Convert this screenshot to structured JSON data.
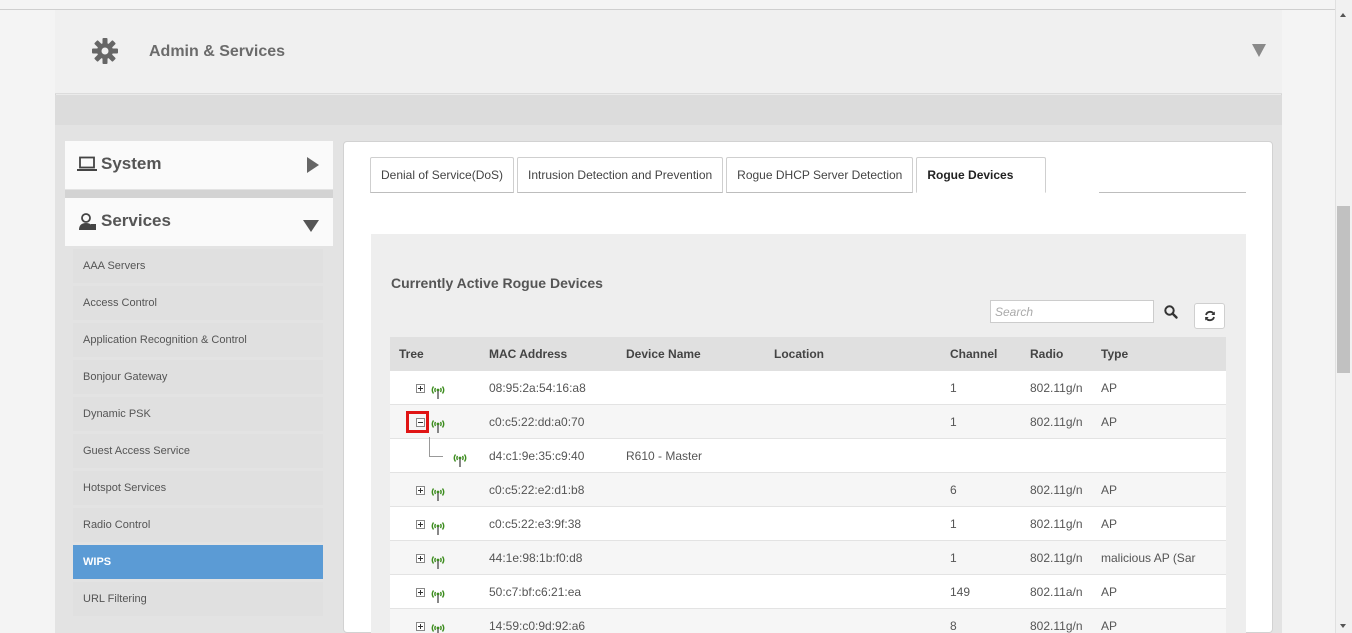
{
  "header": {
    "title": "Admin & Services",
    "icon": "gear-icon"
  },
  "nav": {
    "system": {
      "label": "System",
      "icon": "laptop-icon"
    },
    "services": {
      "label": "Services",
      "icon": "services-icon"
    },
    "items": [
      {
        "label": "AAA Servers",
        "active": false
      },
      {
        "label": "Access Control",
        "active": false
      },
      {
        "label": "Application Recognition & Control",
        "active": false
      },
      {
        "label": "Bonjour Gateway",
        "active": false
      },
      {
        "label": "Dynamic PSK",
        "active": false
      },
      {
        "label": "Guest Access Service",
        "active": false
      },
      {
        "label": "Hotspot Services",
        "active": false
      },
      {
        "label": "Radio Control",
        "active": false
      },
      {
        "label": "WIPS",
        "active": true
      },
      {
        "label": "URL Filtering",
        "active": false
      }
    ]
  },
  "tabs": [
    {
      "label": "Denial of Service(DoS)",
      "active": false
    },
    {
      "label": "Intrusion Detection and Prevention",
      "active": false
    },
    {
      "label": "Rogue DHCP Server Detection",
      "active": false
    },
    {
      "label": "Rogue Devices",
      "active": true
    }
  ],
  "section": {
    "title": "Currently Active Rogue Devices"
  },
  "search": {
    "placeholder": "Search"
  },
  "table": {
    "headers": [
      "Tree",
      "MAC Address",
      "Device Name",
      "Location",
      "Channel",
      "Radio",
      "Type"
    ],
    "rows": [
      {
        "mac": "08:95:2a:54:16:a8",
        "name": "",
        "location": "",
        "channel": "1",
        "radio": "802.11g/n",
        "type": "AP",
        "state": "collapsed"
      },
      {
        "mac": "c0:c5:22:dd:a0:70",
        "name": "",
        "location": "",
        "channel": "1",
        "radio": "802.11g/n",
        "type": "AP",
        "state": "expanded"
      },
      {
        "mac": "d4:c1:9e:35:c9:40",
        "name": "R610 - Master",
        "location": "",
        "channel": "",
        "radio": "",
        "type": "",
        "state": "child"
      },
      {
        "mac": "c0:c5:22:e2:d1:b8",
        "name": "",
        "location": "",
        "channel": "6",
        "radio": "802.11g/n",
        "type": "AP",
        "state": "collapsed"
      },
      {
        "mac": "c0:c5:22:e3:9f:38",
        "name": "",
        "location": "",
        "channel": "1",
        "radio": "802.11g/n",
        "type": "AP",
        "state": "collapsed"
      },
      {
        "mac": "44:1e:98:1b:f0:d8",
        "name": "",
        "location": "",
        "channel": "1",
        "radio": "802.11g/n",
        "type": "malicious AP (Sar",
        "state": "collapsed"
      },
      {
        "mac": "50:c7:bf:c6:21:ea",
        "name": "",
        "location": "",
        "channel": "149",
        "radio": "802.11a/n",
        "type": "AP",
        "state": "collapsed"
      },
      {
        "mac": "14:59:c0:9d:92:a6",
        "name": "",
        "location": "",
        "channel": "8",
        "radio": "802.11g/n",
        "type": "AP",
        "state": "collapsed"
      }
    ]
  },
  "colors": {
    "active_nav": "#5b9bd5",
    "highlight": "#e01414",
    "ap_icon": "#3c8c1e"
  }
}
